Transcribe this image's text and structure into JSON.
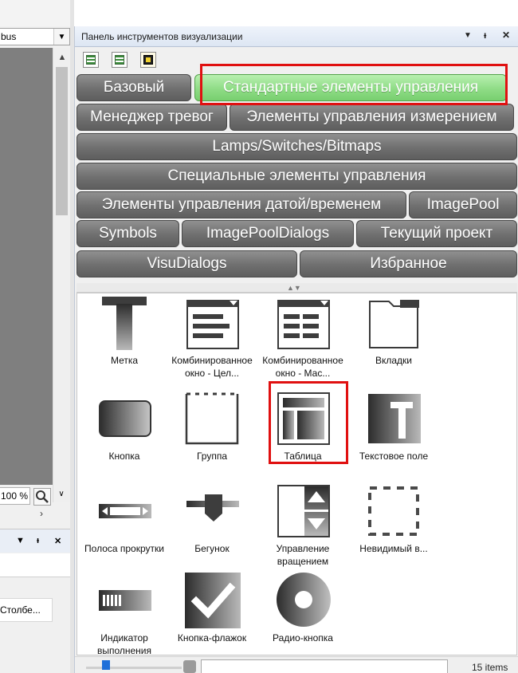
{
  "left_panel": {
    "combo_value": "bus",
    "zoom_value": "100 %",
    "grid_cell": "Столбе..."
  },
  "toolbox": {
    "title": "Панель инструментов визуализации",
    "controls": {
      "dropdown": "▼",
      "pin": "ᵼ",
      "close": "✕"
    },
    "categories": [
      {
        "label": "Базовый"
      },
      {
        "label": "Стандартные элементы управления",
        "active": true
      },
      {
        "label": "Менеджер тревог"
      },
      {
        "label": "Элементы управления измерением"
      },
      {
        "label": "Lamps/Switches/Bitmaps"
      },
      {
        "label": "Специальные элементы управления"
      },
      {
        "label": "Элементы управления датой/временем"
      },
      {
        "label": "ImagePool"
      },
      {
        "label": "Symbols"
      },
      {
        "label": "ImagePoolDialogs"
      },
      {
        "label": "Текущий проект"
      },
      {
        "label": "VisuDialogs"
      },
      {
        "label": "Избранное"
      }
    ],
    "items": [
      {
        "label": "Метка",
        "icon": "label-icon"
      },
      {
        "label": "Комбинированное окно - Цел...",
        "icon": "combobox-integer-icon"
      },
      {
        "label": "Комбинированное окно - Мас...",
        "icon": "combobox-array-icon"
      },
      {
        "label": "Вкладки",
        "icon": "tabs-icon"
      },
      {
        "label": "Кнопка",
        "icon": "button-icon"
      },
      {
        "label": "Группа",
        "icon": "group-icon"
      },
      {
        "label": "Таблица",
        "icon": "table-icon"
      },
      {
        "label": "Текстовое поле",
        "icon": "textfield-icon"
      },
      {
        "label": "Полоса прокрутки",
        "icon": "scrollbar-icon"
      },
      {
        "label": "Бегунок",
        "icon": "slider-icon"
      },
      {
        "label": "Управление вращением",
        "icon": "spin-control-icon"
      },
      {
        "label": "Невидимый в...",
        "icon": "invisible-input-icon"
      },
      {
        "label": "Индикатор выполнения",
        "icon": "progress-bar-icon"
      },
      {
        "label": "Кнопка-флажок",
        "icon": "checkbox-icon"
      },
      {
        "label": "Радио-кнопка",
        "icon": "radio-button-icon"
      }
    ],
    "status": {
      "count": "15 items"
    }
  },
  "accent": {
    "highlight": "#e01010",
    "active_category": "#8fdc86"
  }
}
